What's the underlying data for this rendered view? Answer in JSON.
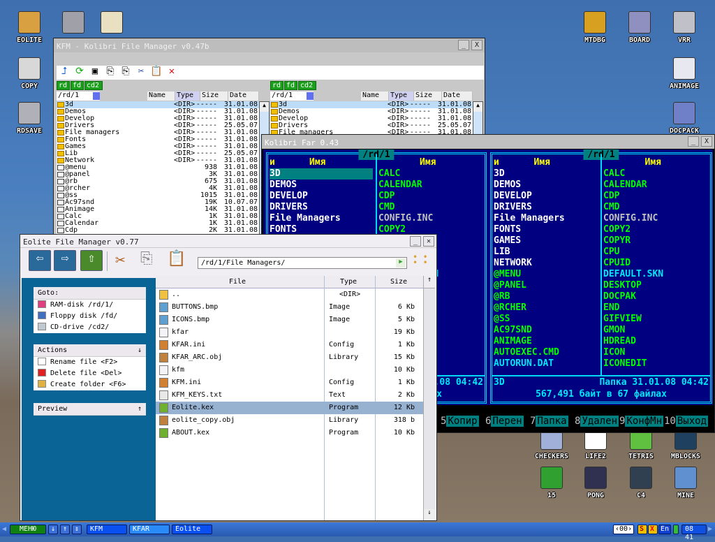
{
  "desktop": {
    "icons_left": [
      {
        "label": "EOLITE",
        "icon": "folder-icon",
        "color": "#d8a040"
      },
      {
        "label": "",
        "icon": "hdd-tool-icon",
        "color": "#a0a0a8"
      },
      {
        "label": "",
        "icon": "notepad-icon",
        "color": "#e8e0c0"
      },
      {
        "label": "COPY",
        "icon": "copy-icon",
        "color": "#d8d8d8"
      },
      {
        "label": "RDSAVE",
        "icon": "rdsave-icon",
        "color": "#b0b0b8"
      }
    ],
    "icons_right": [
      {
        "label": "MTDBG",
        "icon": "debugger-icon",
        "color": "#d8a020"
      },
      {
        "label": "BOARD",
        "icon": "board-icon",
        "color": "#9090c0"
      },
      {
        "label": "VRR",
        "icon": "monitor-icon",
        "color": "#c0c0c8"
      },
      {
        "label": "ANIMAGE",
        "icon": "animage-icon",
        "color": "#e8e8f0"
      },
      {
        "label": "DOCPACK",
        "icon": "cabinet-icon",
        "color": "#7080c8"
      }
    ],
    "icons_games": [
      {
        "label": "CHECKERS",
        "icon": "checkers-icon",
        "color": "#a0b0d8"
      },
      {
        "label": "LIFE2",
        "icon": "life-icon",
        "color": "#ffffff"
      },
      {
        "label": "TETRIS",
        "icon": "tetris-icon",
        "color": "#60c040"
      },
      {
        "label": "MBLOCKS",
        "icon": "mblocks-icon",
        "color": "#204060"
      },
      {
        "label": "15",
        "icon": "fifteen-icon",
        "color": "#30a030"
      },
      {
        "label": "PONG",
        "icon": "pong-icon",
        "color": "#303050"
      },
      {
        "label": "C4",
        "icon": "connect4-icon",
        "color": "#304050"
      },
      {
        "label": "MINE",
        "icon": "mine-icon",
        "color": "#6090d0"
      }
    ]
  },
  "kfm": {
    "title": "KFM - Kolibri File Manager v0.47b",
    "drives": [
      "rd",
      "fd",
      "cd2"
    ],
    "path": "/rd/1",
    "columns": [
      "Name",
      "Type",
      "Size",
      "Date"
    ],
    "files": [
      {
        "name": "3d",
        "type": "<DIR>",
        "size": "-----",
        "date": "31.01.08",
        "dir": true
      },
      {
        "name": "Demos",
        "type": "<DIR>",
        "size": "-----",
        "date": "31.01.08",
        "dir": true
      },
      {
        "name": "Develop",
        "type": "<DIR>",
        "size": "-----",
        "date": "31.01.08",
        "dir": true
      },
      {
        "name": "Drivers",
        "type": "<DIR>",
        "size": "-----",
        "date": "25.05.07",
        "dir": true
      },
      {
        "name": "File managers",
        "type": "<DIR>",
        "size": "-----",
        "date": "31.01.08",
        "dir": true
      },
      {
        "name": "Fonts",
        "type": "<DIR>",
        "size": "-----",
        "date": "31.01.08",
        "dir": true
      },
      {
        "name": "Games",
        "type": "<DIR>",
        "size": "-----",
        "date": "31.01.08",
        "dir": true
      },
      {
        "name": "Lib",
        "type": "<DIR>",
        "size": "-----",
        "date": "25.05.07",
        "dir": true
      },
      {
        "name": "Network",
        "type": "<DIR>",
        "size": "-----",
        "date": "31.01.08",
        "dir": true
      },
      {
        "name": "@menu",
        "type": "",
        "size": "938",
        "date": "31.01.08"
      },
      {
        "name": "@panel",
        "type": "",
        "size": "3K",
        "date": "31.01.08"
      },
      {
        "name": "@rb",
        "type": "",
        "size": "675",
        "date": "31.01.08"
      },
      {
        "name": "@rcher",
        "type": "",
        "size": "4K",
        "date": "31.01.08"
      },
      {
        "name": "@ss",
        "type": "",
        "size": "1015",
        "date": "31.01.08"
      },
      {
        "name": "Ac97snd",
        "type": "",
        "size": "19K",
        "date": "10.07.07"
      },
      {
        "name": "Animage",
        "type": "",
        "size": "14K",
        "date": "31.01.08"
      },
      {
        "name": "Calc",
        "type": "",
        "size": "1K",
        "date": "31.01.08"
      },
      {
        "name": "Calendar",
        "type": "",
        "size": "1K",
        "date": "31.01.08"
      },
      {
        "name": "Cdp",
        "type": "",
        "size": "2K",
        "date": "31.01.08"
      }
    ]
  },
  "far": {
    "title": "Kolibri Far 0.43",
    "panel_title": "/rd/1",
    "col_header": "Имя",
    "sort_indicator": "и",
    "col1": [
      {
        "n": "3D",
        "c": "#ffffff"
      },
      {
        "n": "DEMOS",
        "c": "#ffffff"
      },
      {
        "n": "DEVELOP",
        "c": "#ffffff"
      },
      {
        "n": "DRIVERS",
        "c": "#ffffff"
      },
      {
        "n": "File Managers",
        "c": "#ffffff"
      },
      {
        "n": "FONTS",
        "c": "#ffffff"
      },
      {
        "n": "GAMES",
        "c": "#ffffff"
      },
      {
        "n": "LIB",
        "c": "#ffffff"
      },
      {
        "n": "NETWORK",
        "c": "#ffffff"
      },
      {
        "n": "@MENU",
        "c": "#00ff00"
      },
      {
        "n": "@PANEL",
        "c": "#00ff00"
      },
      {
        "n": "@RB",
        "c": "#00ff00"
      },
      {
        "n": "@RCHER",
        "c": "#00ff00"
      },
      {
        "n": "@SS",
        "c": "#00ff00"
      },
      {
        "n": "AC97SND",
        "c": "#00ff00"
      },
      {
        "n": "ANIMAGE",
        "c": "#00ff00"
      },
      {
        "n": "AUTOEXEC.CMD",
        "c": "#00ff00"
      },
      {
        "n": "AUTORUN.DAT",
        "c": "#00e8f8"
      }
    ],
    "col2": [
      {
        "n": "CALC",
        "c": "#00ff00"
      },
      {
        "n": "CALENDAR",
        "c": "#00ff00"
      },
      {
        "n": "CDP",
        "c": "#00ff00"
      },
      {
        "n": "CMD",
        "c": "#00ff00"
      },
      {
        "n": "CONFIG.INC",
        "c": "#c0c0c0"
      },
      {
        "n": "COPY2",
        "c": "#00ff00"
      },
      {
        "n": "COPYR",
        "c": "#00ff00"
      },
      {
        "n": "CPU",
        "c": "#00ff00"
      },
      {
        "n": "CPUID",
        "c": "#00ff00"
      },
      {
        "n": "DEFAULT.SKN",
        "c": "#00e8f8"
      },
      {
        "n": "DESKTOP",
        "c": "#00ff00"
      },
      {
        "n": "DOCPAK",
        "c": "#00ff00"
      },
      {
        "n": "END",
        "c": "#00ff00"
      },
      {
        "n": "GIFVIEW",
        "c": "#00ff00"
      },
      {
        "n": "GMON",
        "c": "#00ff00"
      },
      {
        "n": "HDREAD",
        "c": "#00ff00"
      },
      {
        "n": "ICON",
        "c": "#00ff00"
      },
      {
        "n": "ICONEDIT",
        "c": "#00ff00"
      }
    ],
    "footer_name": "3D",
    "footer_info": "Папка 31.01.08 04:42",
    "summary": "567,491 байт в 67 файлах",
    "fkeys": [
      {
        "num": "5",
        "label": "Копир"
      },
      {
        "num": "6",
        "label": "Перен"
      },
      {
        "num": "7",
        "label": "Папка"
      },
      {
        "num": "8",
        "label": "Удален"
      },
      {
        "num": "9",
        "label": "КонфМн"
      },
      {
        "num": "10",
        "label": "Выход"
      }
    ]
  },
  "eolite": {
    "title": "Eolite File Manager v0.77",
    "path": "/rd/1/File Managers/",
    "goto": {
      "title": "Goto:",
      "items": [
        {
          "label": "RAM-disk /rd/1/",
          "icon": "ramdisk-icon",
          "color": "#e04080"
        },
        {
          "label": "Floppy disk /fd/",
          "icon": "floppy-icon",
          "color": "#4070c0"
        },
        {
          "label": "CD-drive /cd2/",
          "icon": "cd-icon",
          "color": "#c0c8d0"
        }
      ]
    },
    "actions": {
      "title": "Actions",
      "arrow": "↓",
      "items": [
        {
          "label": "Rename file <F2>",
          "icon": "rename-icon",
          "color": "#ffffff"
        },
        {
          "label": "Delete file <Del>",
          "icon": "delete-icon",
          "color": "#e02020"
        },
        {
          "label": "Create folder <F6>",
          "icon": "new-folder-icon",
          "color": "#e0b040"
        }
      ]
    },
    "preview": {
      "title": "Preview",
      "arrow": "↑"
    },
    "columns": {
      "file": "File",
      "type": "Type",
      "size": "Size",
      "sort": "↑"
    },
    "files": [
      {
        "name": "..",
        "type": "<DIR>",
        "size": "",
        "icon": "folder-icon"
      },
      {
        "name": "BUTTONS.bmp",
        "type": "Image",
        "size": "6 Kb",
        "icon": "image-icon"
      },
      {
        "name": "ICONS.bmp",
        "type": "Image",
        "size": "5 Kb",
        "icon": "image-icon"
      },
      {
        "name": "kfar",
        "type": "",
        "size": "19 Kb",
        "icon": "file-icon"
      },
      {
        "name": "KFAR.ini",
        "type": "Config",
        "size": "1 Kb",
        "icon": "config-icon"
      },
      {
        "name": "KFAR_ARC.obj",
        "type": "Library",
        "size": "15 Kb",
        "icon": "library-icon"
      },
      {
        "name": "kfm",
        "type": "",
        "size": "10 Kb",
        "icon": "file-icon"
      },
      {
        "name": "KFM.ini",
        "type": "Config",
        "size": "1 Kb",
        "icon": "config-icon"
      },
      {
        "name": "KFM_KEYS.txt",
        "type": "Text",
        "size": "2 Kb",
        "icon": "text-icon"
      },
      {
        "name": "Eolite.kex",
        "type": "Program",
        "size": "12 Kb",
        "icon": "program-icon",
        "selected": true
      },
      {
        "name": "eolite_copy.obj",
        "type": "Library",
        "size": "318 b",
        "icon": "library-icon"
      },
      {
        "name": "ABOUT.kex",
        "type": "Program",
        "size": "10 Kb",
        "icon": "program-icon"
      }
    ]
  },
  "taskbar": {
    "menu": "МЕНЮ",
    "arrows": [
      "↓",
      "↑",
      "⇕"
    ],
    "tasks": [
      "KFM",
      "KFAR",
      "Eolite"
    ],
    "counter": "00",
    "lang": "En",
    "clock": "08 41",
    "tray_s": "S",
    "tray_x": "X"
  },
  "colors": {
    "far_bg": "#000080",
    "far_frame": "#00d8f8",
    "eolite_side": "#0a6496",
    "taskbar": "#3a78d8"
  }
}
